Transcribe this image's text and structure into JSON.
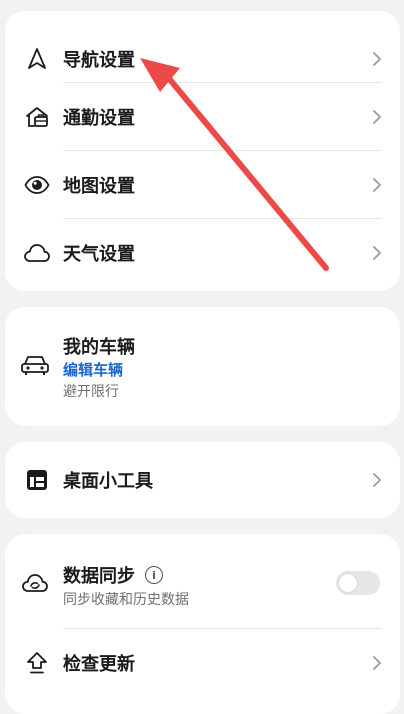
{
  "settings_group_1": {
    "items": [
      {
        "label": "导航设置",
        "icon": "navigation-arrow-icon"
      },
      {
        "label": "通勤设置",
        "icon": "commute-briefcase-icon"
      },
      {
        "label": "地图设置",
        "icon": "eye-icon"
      },
      {
        "label": "天气设置",
        "icon": "cloud-icon"
      }
    ]
  },
  "vehicle": {
    "title": "我的车辆",
    "edit_label": "编辑车辆",
    "restriction": "避开限行",
    "icon": "car-icon"
  },
  "widgets": {
    "label": "桌面小工具",
    "icon": "widgets-icon"
  },
  "sync": {
    "title": "数据同步",
    "info_icon": "i",
    "description": "同步收藏和历史数据",
    "toggle_on": false,
    "icon": "cloud-sync-icon"
  },
  "update": {
    "label": "检查更新",
    "icon": "upload-icon"
  },
  "colors": {
    "link": "#1a68c9",
    "annotation_arrow": "#ec4a48"
  }
}
